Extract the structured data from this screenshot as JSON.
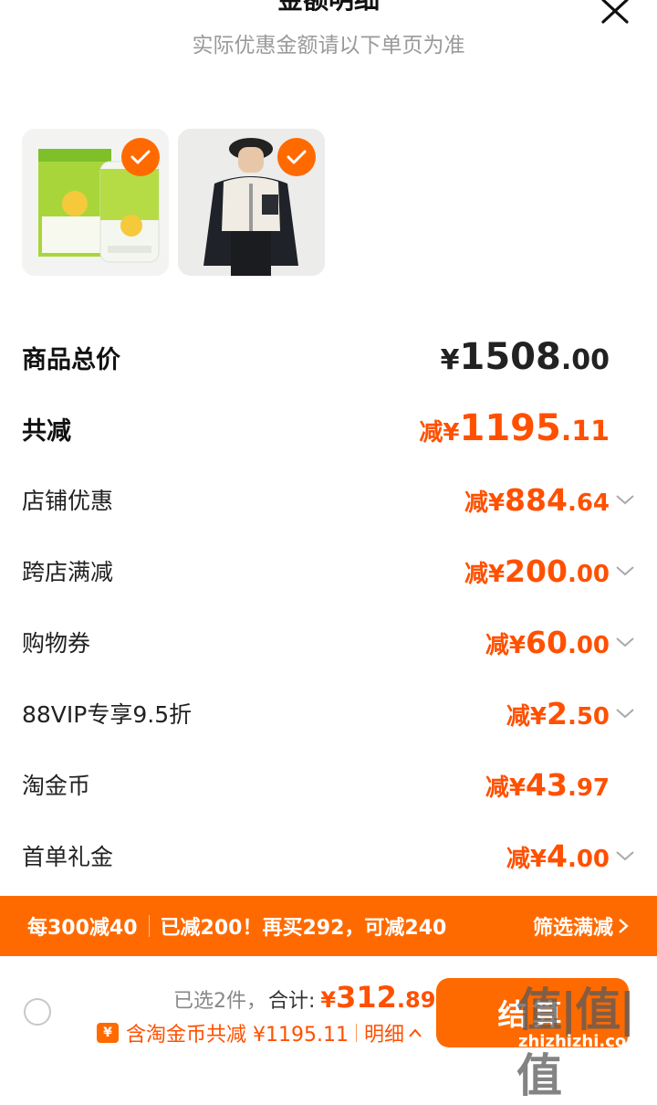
{
  "header": {
    "title": "金额明细",
    "subtitle": "实际优惠金额请以下单页为准"
  },
  "products": [
    {
      "name": "vitamin-supplement-bottle",
      "selected": true
    },
    {
      "name": "fleece-jacket-model",
      "selected": true
    }
  ],
  "rows": {
    "total": {
      "label": "商品总价",
      "prefix": "¥",
      "int": "1508",
      "dec": ".00"
    },
    "discount": {
      "label": "共减",
      "prefix": "减¥",
      "int": "1195",
      "dec": ".11"
    },
    "shop": {
      "label": "店铺优惠",
      "prefix": "减¥",
      "int": "884",
      "dec": ".64"
    },
    "cross": {
      "label": "跨店满减",
      "prefix": "减¥",
      "int": "200",
      "dec": ".00"
    },
    "coupon": {
      "label": "购物券",
      "prefix": "减¥",
      "int": "60",
      "dec": ".00"
    },
    "vip": {
      "label": "88VIP专享9.5折",
      "prefix": "减¥",
      "int": "2",
      "dec": ".50"
    },
    "coin": {
      "label": "淘金币",
      "prefix": "减¥",
      "int": "43",
      "dec": ".97"
    },
    "first": {
      "label": "首单礼金",
      "prefix": "减¥",
      "int": "4",
      "dec": ".00"
    }
  },
  "banner": {
    "tag": "每300减40",
    "message": "已减200！再买292，可减240",
    "filter": "筛选满减"
  },
  "bottom": {
    "selected_count": "已选2件，",
    "total_label": "合计:",
    "currency": "¥",
    "price_int": "312",
    "price_dec": ".89",
    "coin_icon": "¥",
    "coin_text": "含淘金币共减 ¥1195.11",
    "detail": "明细",
    "checkout": "结算"
  },
  "watermark": {
    "main": "值|值|值",
    "site": "zhizhizhi.com"
  },
  "colors": {
    "accent": "#ff6a00",
    "discount_text": "#ff5000"
  }
}
